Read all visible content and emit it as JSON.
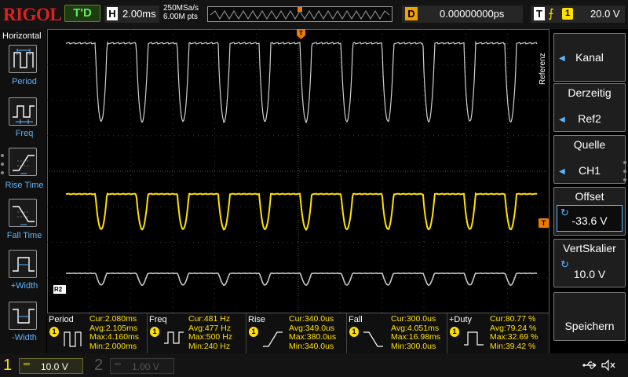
{
  "topbar": {
    "logo": "RIGOL",
    "run_state": "T'D",
    "horizontal": {
      "letter": "H",
      "scale": "2.00ms"
    },
    "sample_rate": "250MSa/s",
    "memory_points": "6.00M pts",
    "delay": {
      "letter": "D",
      "value": "0.00000000ps"
    },
    "trigger": {
      "letter": "T",
      "edge_symbol": "⨍",
      "source": "1",
      "level": "20.0 V"
    }
  },
  "left_panel": {
    "title": "Horizontal",
    "items": [
      {
        "label": "Period",
        "icon": "period-icon"
      },
      {
        "label": "Freq",
        "icon": "frequency-icon"
      },
      {
        "label": "Rise Time",
        "icon": "rise-time-icon"
      },
      {
        "label": "Fall Time",
        "icon": "fall-time-icon"
      },
      {
        "label": "+Width",
        "icon": "positive-width-icon"
      },
      {
        "label": "-Width",
        "icon": "negative-width-icon"
      }
    ]
  },
  "right_panel": {
    "vertical_title": "Referenz",
    "items": [
      {
        "title": "",
        "value": "Kanal",
        "control": "arrow"
      },
      {
        "title": "Derzeitig",
        "value": "Ref2",
        "control": "arrow"
      },
      {
        "title": "Quelle",
        "value": "CH1",
        "control": "arrow"
      },
      {
        "title": "Offset",
        "value": "-33.6 V",
        "control": "knob"
      },
      {
        "title": "VertSkalier",
        "value": "10.0 V",
        "control": "knob"
      },
      {
        "title": "",
        "value": "Speichern",
        "control": "none"
      }
    ]
  },
  "markers": {
    "ch1_level": "T",
    "trigger_position": "T",
    "ref": "R2"
  },
  "measurements": [
    {
      "name": "Period",
      "source": "1",
      "icon": "period-icon",
      "cur": "Cur:2.080ms",
      "avg": "Avg:2.105ms",
      "max": "Max:4.160ms",
      "min": "Min:2.000ms"
    },
    {
      "name": "Freq",
      "source": "1",
      "icon": "frequency-icon",
      "cur": "Cur:481 Hz",
      "avg": "Avg:477 Hz",
      "max": "Max:500 Hz",
      "min": "Min:240 Hz"
    },
    {
      "name": "Rise",
      "source": "1",
      "icon": "rise-time-icon",
      "cur": "Cur:340.0us",
      "avg": "Avg:349.0us",
      "max": "Max:380.0us",
      "min": "Min:340.0us"
    },
    {
      "name": "Fall",
      "source": "1",
      "icon": "fall-time-icon",
      "cur": "Cur:300.0us",
      "avg": "Avg:4.051ms",
      "max": "Max:16.98ms",
      "min": "Min:300.0us"
    },
    {
      "name": "+Duty",
      "source": "1",
      "icon": "duty-cycle-icon",
      "cur": "Cur:80.77 %",
      "avg": "Avg:79.24 %",
      "max": "Max:32.69 %",
      "min": "Min:39.42 %"
    }
  ],
  "bottombar": {
    "ch1": {
      "number": "1",
      "coupling": "═",
      "scale": "10.0 V"
    },
    "ch2": {
      "number": "2",
      "coupling": "═",
      "scale": "1.00 V"
    }
  },
  "colors": {
    "ch1": "#ffe000",
    "reference": "#d0d0d0",
    "accent_blue": "#5db4ff",
    "trigger_orange": "#f07a00",
    "logo_red": "#e02020"
  }
}
